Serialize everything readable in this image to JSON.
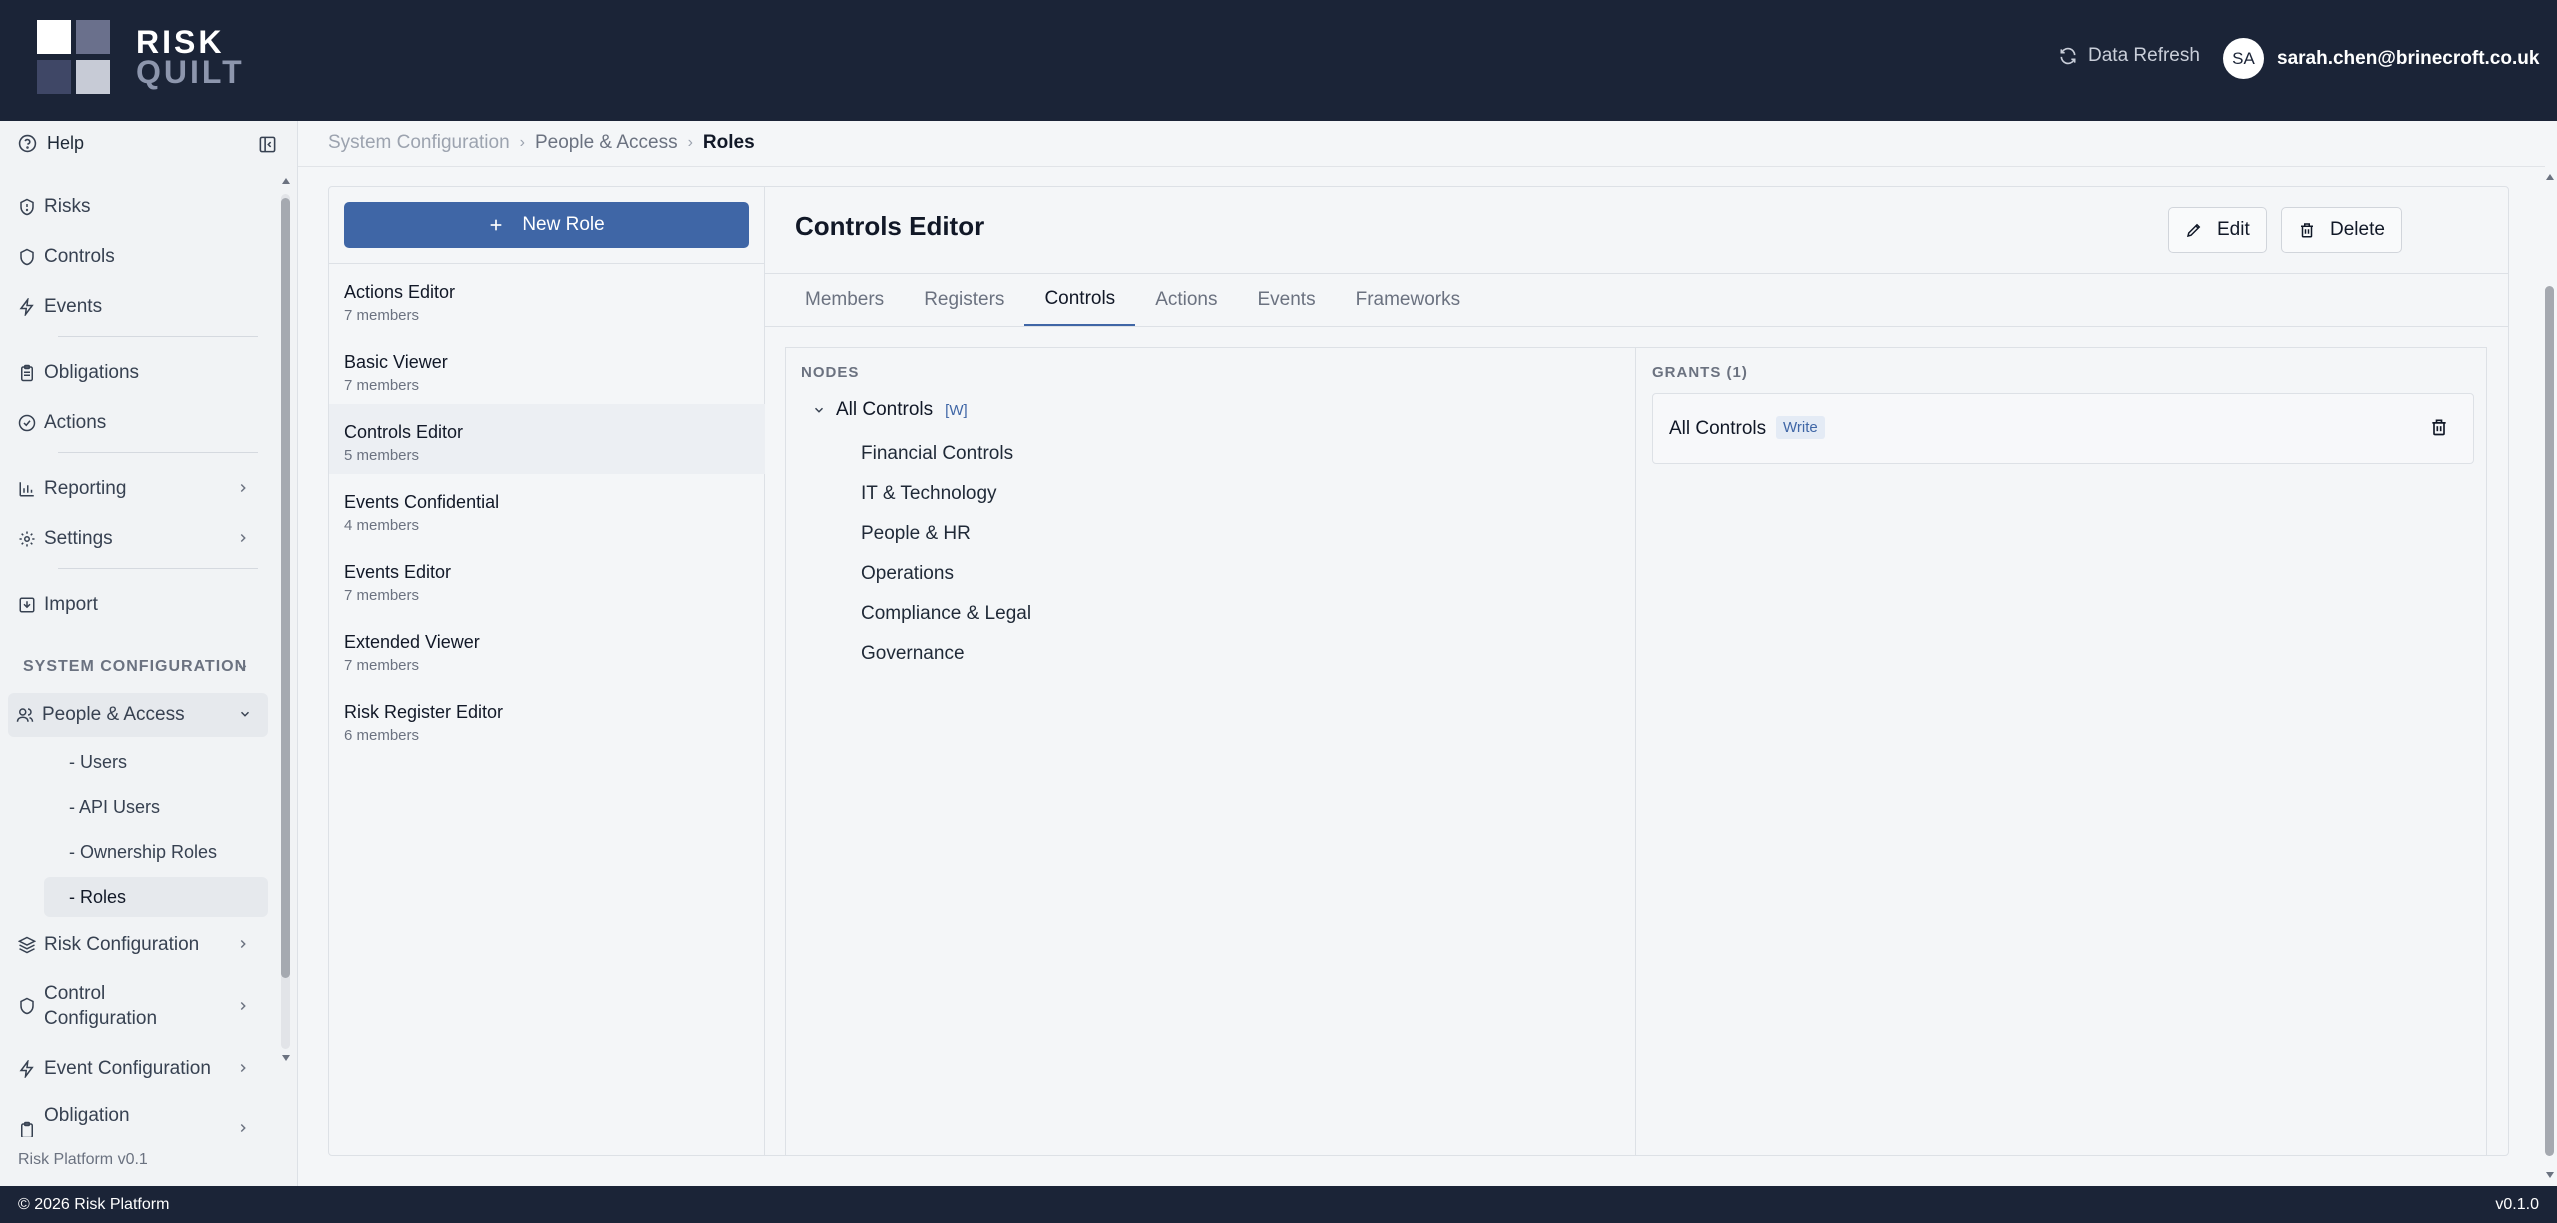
{
  "app": {
    "logo_line1": "RISK",
    "logo_line2": "QUILT",
    "data_refresh": "Data Refresh",
    "user_initials": "SA",
    "user_email": "sarah.chen@brinecroft.co.uk"
  },
  "sidebar": {
    "help": "Help",
    "items": [
      {
        "label": "Risks",
        "icon": "shield-alert-icon"
      },
      {
        "label": "Controls",
        "icon": "shield-icon"
      },
      {
        "label": "Events",
        "icon": "bolt-icon"
      },
      {
        "label": "Obligations",
        "icon": "clipboard-icon"
      },
      {
        "label": "Actions",
        "icon": "check-circle-icon"
      },
      {
        "label": "Reporting",
        "icon": "bar-chart-icon"
      },
      {
        "label": "Settings",
        "icon": "gear-icon"
      },
      {
        "label": "Import",
        "icon": "import-icon"
      }
    ],
    "section_title": "SYSTEM CONFIGURATION",
    "people_access": "People & Access",
    "sub_items": [
      "- Users",
      "- API Users",
      "- Ownership Roles",
      "- Roles"
    ],
    "config_items": [
      "Risk Configuration",
      "Control Configuration",
      "Event Configuration",
      "Obligation"
    ],
    "footer": "Risk Platform v0.1"
  },
  "breadcrumb": [
    "System Configuration",
    "People & Access",
    "Roles"
  ],
  "roles_panel": {
    "new_role_label": "New Role",
    "roles": [
      {
        "name": "Actions Editor",
        "members": "7 members"
      },
      {
        "name": "Basic Viewer",
        "members": "7 members"
      },
      {
        "name": "Controls Editor",
        "members": "5 members"
      },
      {
        "name": "Events Confidential",
        "members": "4 members"
      },
      {
        "name": "Events Editor",
        "members": "7 members"
      },
      {
        "name": "Extended Viewer",
        "members": "7 members"
      },
      {
        "name": "Risk Register Editor",
        "members": "6 members"
      }
    ]
  },
  "detail": {
    "title": "Controls Editor",
    "edit_label": "Edit",
    "delete_label": "Delete",
    "tabs": [
      "Members",
      "Registers",
      "Controls",
      "Actions",
      "Events",
      "Frameworks"
    ],
    "active_tab": "Controls",
    "nodes_header": "NODES",
    "root_node": "All Controls",
    "root_tag": "[W]",
    "child_nodes": [
      "Financial Controls",
      "IT & Technology",
      "People & HR",
      "Operations",
      "Compliance & Legal",
      "Governance"
    ],
    "grants_header": "GRANTS (1)",
    "grant_name": "All Controls",
    "grant_level": "Write"
  },
  "footer": {
    "copyright": "© 2026 Risk Platform",
    "version": "v0.1.0"
  },
  "colors": {
    "header_bg": "#1b2437",
    "accent": "#3f66a6"
  }
}
